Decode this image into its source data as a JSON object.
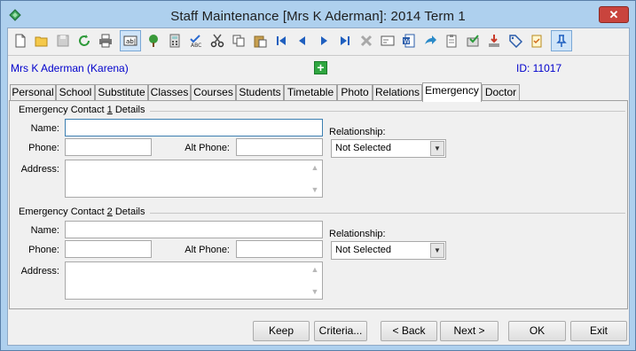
{
  "window": {
    "title": "Staff Maintenance  [Mrs K Aderman]:  2014 Term 1",
    "close_label": "✕"
  },
  "toolbar": {
    "icons": [
      "new-icon",
      "open-icon",
      "save-icon",
      "refresh-icon",
      "print-icon",
      "text-field-icon",
      "tree-icon",
      "calculator-icon",
      "spellcheck-icon",
      "cut-icon",
      "copy-icon",
      "paste-icon",
      "first-record-icon",
      "previous-record-icon",
      "next-record-icon",
      "last-record-icon",
      "delete-icon",
      "card-icon",
      "word-icon",
      "forward-icon",
      "clipboard-icon",
      "approve-icon",
      "download-icon",
      "tag-icon",
      "checklist-icon",
      "pin-icon"
    ]
  },
  "staff": {
    "name": "Mrs K Aderman (Karena)",
    "id_label": "ID: 11017"
  },
  "tabs": [
    "Personal",
    "School",
    "Substitute",
    "Classes",
    "Courses",
    "Students",
    "Timetable",
    "Photo",
    "Relations",
    "Emergency",
    "Doctor"
  ],
  "active_tab": "Emergency",
  "contact1": {
    "title_prefix": "Emergency Contact ",
    "title_num": "1",
    "title_suffix": " Details",
    "name_label": "Name:",
    "name_value": "",
    "phone_label": "Phone:",
    "phone_value": "",
    "alt_phone_label": "Alt Phone:",
    "alt_phone_value": "",
    "address_label": "Address:",
    "address_value": "",
    "relationship_label": "Relationship:",
    "relationship_value": "Not Selected"
  },
  "contact2": {
    "title_prefix": "Emergency Contact ",
    "title_num": "2",
    "title_suffix": " Details",
    "name_label": "Name:",
    "name_value": "",
    "phone_label": "Phone:",
    "phone_value": "",
    "alt_phone_label": "Alt Phone:",
    "alt_phone_value": "",
    "address_label": "Address:",
    "address_value": "",
    "relationship_label": "Relationship:",
    "relationship_value": "Not Selected"
  },
  "buttons": {
    "keep": "Keep",
    "criteria": "Criteria...",
    "back": "< Back",
    "next": "Next >",
    "ok": "OK",
    "exit": "Exit"
  }
}
